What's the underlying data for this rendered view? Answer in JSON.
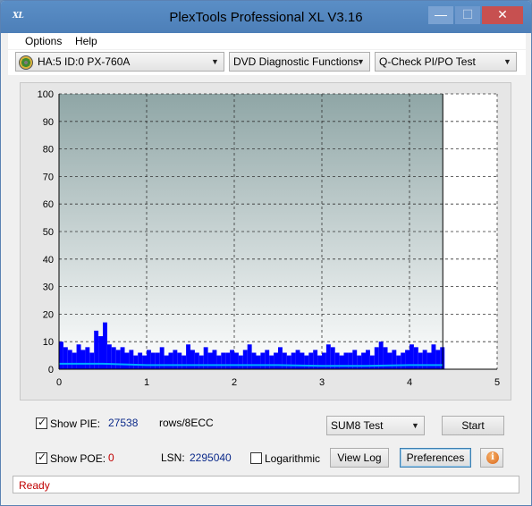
{
  "window": {
    "title": "PlexTools Professional XL V3.16",
    "app_icon_text": "XL",
    "minimize_glyph": "—",
    "maximize_glyph": "☐",
    "close_glyph": "✕"
  },
  "menu": {
    "items": [
      {
        "label": "Options",
        "accel": "O"
      },
      {
        "label": "Help",
        "accel": "H"
      }
    ]
  },
  "toolbar": {
    "drive": "HA:5 ID:0  PX-760A",
    "function": "DVD Diagnostic Functions",
    "test": "Q-Check PI/PO Test",
    "dropdown_glyph": "▼"
  },
  "chart_data": {
    "type": "bar",
    "title": "",
    "xlabel": "",
    "ylabel": "",
    "x_ticks": [
      0,
      1,
      2,
      3,
      4,
      5
    ],
    "y_ticks": [
      0,
      10,
      20,
      30,
      40,
      50,
      60,
      70,
      80,
      90,
      100
    ],
    "xlim": [
      0,
      5
    ],
    "ylim": [
      0,
      100
    ],
    "grid": true,
    "data_end_x": 4.38,
    "series": [
      {
        "type": "bar",
        "color": "#0000ff",
        "x": [
          0.0,
          0.05,
          0.1,
          0.15,
          0.2,
          0.25,
          0.3,
          0.35,
          0.4,
          0.45,
          0.48,
          0.5,
          0.55,
          0.6,
          0.65,
          0.7,
          0.75,
          0.8,
          0.85,
          0.9,
          0.95,
          1.0,
          1.05,
          1.1,
          1.15,
          1.2,
          1.25,
          1.3,
          1.35,
          1.4,
          1.45,
          1.5,
          1.55,
          1.6,
          1.65,
          1.7,
          1.75,
          1.8,
          1.85,
          1.9,
          1.95,
          2.0,
          2.05,
          2.1,
          2.15,
          2.2,
          2.25,
          2.3,
          2.35,
          2.4,
          2.45,
          2.5,
          2.55,
          2.6,
          2.65,
          2.7,
          2.75,
          2.8,
          2.85,
          2.9,
          2.95,
          3.0,
          3.05,
          3.1,
          3.15,
          3.2,
          3.25,
          3.3,
          3.35,
          3.4,
          3.45,
          3.5,
          3.55,
          3.6,
          3.65,
          3.7,
          3.75,
          3.8,
          3.85,
          3.9,
          3.95,
          4.0,
          4.05,
          4.1,
          4.15,
          4.2,
          4.25,
          4.3,
          4.35
        ],
        "values": [
          10,
          8,
          7,
          6,
          9,
          7,
          8,
          6,
          14,
          12,
          10,
          17,
          9,
          8,
          7,
          8,
          6,
          7,
          5,
          6,
          5,
          7,
          6,
          6,
          8,
          5,
          6,
          7,
          6,
          5,
          9,
          7,
          6,
          5,
          8,
          6,
          7,
          5,
          6,
          6,
          7,
          6,
          5,
          7,
          9,
          6,
          5,
          6,
          7,
          5,
          6,
          8,
          6,
          5,
          6,
          7,
          6,
          5,
          6,
          7,
          5,
          6,
          9,
          8,
          6,
          5,
          6,
          6,
          7,
          5,
          6,
          7,
          5,
          8,
          10,
          8,
          6,
          7,
          5,
          6,
          7,
          9,
          8,
          6,
          7,
          6,
          9,
          7,
          8
        ]
      },
      {
        "type": "line",
        "color": "#00aaff",
        "x": [
          0.0,
          0.25,
          0.5,
          1.0,
          1.5,
          2.0,
          2.5,
          3.0,
          3.5,
          4.0,
          4.38
        ],
        "values": [
          2,
          2,
          2,
          1.5,
          1.5,
          1.5,
          1.5,
          1.2,
          1.2,
          1.5,
          1.5
        ]
      }
    ]
  },
  "bottom": {
    "show_pie_label": "Show PIE:",
    "pie_value": "27538",
    "pie_unit": "rows/8ECC",
    "show_poe_label": "Show POE:",
    "poe_value": "0",
    "lsn_label": "LSN:",
    "lsn_value": "2295040",
    "logarithmic_label": "Logarithmic",
    "sum_test": "SUM8 Test",
    "start_button": "Start",
    "view_log_button": "View Log",
    "preferences_button": "Preferences",
    "info_glyph": "i"
  },
  "status": {
    "text": "Ready"
  }
}
